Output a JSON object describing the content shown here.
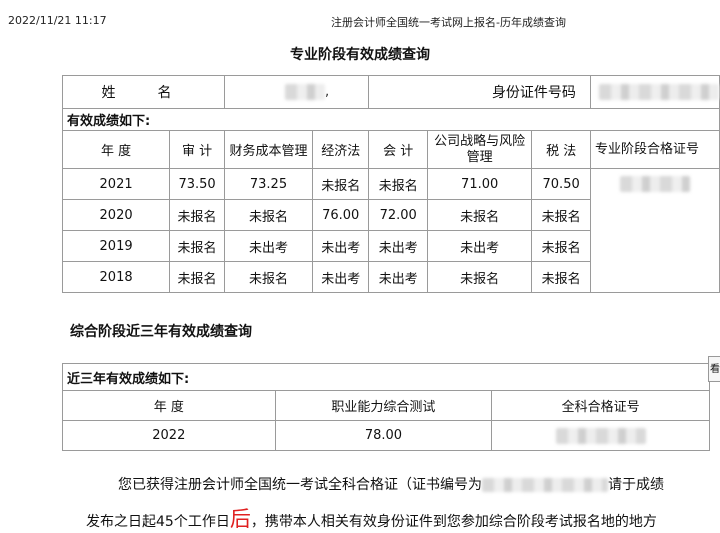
{
  "header": {
    "datetime": "2022/11/21  11:17",
    "page_title": "注册会计师全国统一考试网上报名-历年成绩查询"
  },
  "section1": {
    "title": "专业阶段有效成绩查询",
    "name_label": "姓　名",
    "name_suffix": ",",
    "id_label": "身份证件号码",
    "caption": "有效成绩如下:",
    "columns": [
      "年 度",
      "审 计",
      "财务成本管理",
      "经济法",
      "会 计",
      "公司战略与风险管理",
      "税 法",
      "专业阶段合格证号"
    ],
    "rows": [
      [
        "2021",
        "73.50",
        "73.25",
        "未报名",
        "未报名",
        "71.00",
        "70.50"
      ],
      [
        "2020",
        "未报名",
        "未报名",
        "76.00",
        "72.00",
        "未报名",
        "未报名"
      ],
      [
        "2019",
        "未报名",
        "未出考",
        "未出考",
        "未出考",
        "未出考",
        "未报名"
      ],
      [
        "2018",
        "未报名",
        "未报名",
        "未出考",
        "未出考",
        "未报名",
        "未报名"
      ]
    ]
  },
  "section2": {
    "title": "综合阶段近三年有效成绩查询",
    "caption": "近三年有效成绩如下:",
    "columns": [
      "年 度",
      "职业能力综合测试",
      "全科合格证号"
    ],
    "row": [
      "2022",
      "78.00"
    ]
  },
  "notice": {
    "line1_a": "您已获得注册会计师全国统一考试全科合格证（证书编号为",
    "line1_b": "请于成绩",
    "line2_a": "发布之日起45个工作日",
    "line2_big": "后",
    "line2_b": "，携带本人相关有效身份证件到您参加综合阶段考试报名地的地方"
  },
  "side_tab": "看"
}
